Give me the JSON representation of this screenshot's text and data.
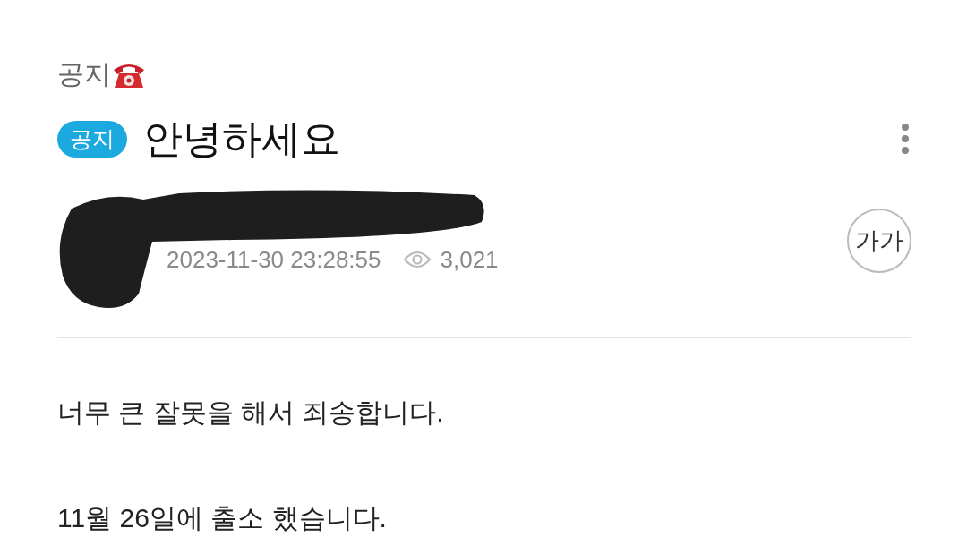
{
  "board": {
    "name": "공지"
  },
  "post": {
    "badge": "공지",
    "title": "안녕하세요",
    "date": "2023-11-30 23:28:55",
    "views": "3,021",
    "font_button": "가가"
  },
  "body": [
    "너무 큰 잘못을 해서 죄송합니다.",
    "11월 26일에 출소 했습니다."
  ]
}
